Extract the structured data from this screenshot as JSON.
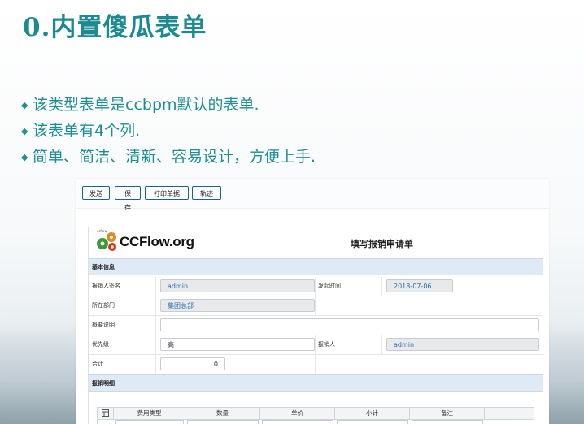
{
  "slide": {
    "title": "0.内置傻瓜表单",
    "bullets": [
      "该类型表单是ccbpm默认的表单.",
      "该表单有4个列.",
      "简单、简洁、清新、容易设计，方便上手."
    ],
    "accent_color": "#1c8a91"
  },
  "toolbar": {
    "send": "发送",
    "save": "保存",
    "print": "打印单据",
    "track": "轨迹"
  },
  "form": {
    "logo_text": "CCFlow.org",
    "logo_small": "ccflow",
    "title": "填写报销申请单",
    "section_basic": "基本信息",
    "section_detail": "报销明细",
    "fields": {
      "signer_label": "报销人签名",
      "signer_value": "admin",
      "time_label": "发起时间",
      "time_value": "2018-07-06",
      "dept_label": "所在部门",
      "dept_value": "集团总部",
      "summary_label": "概要说明",
      "summary_value": "",
      "priority_label": "优先级",
      "priority_value": "高",
      "reimburser_label": "报销人",
      "reimburser_value": "admin",
      "total_label": "合计",
      "total_value": "0"
    },
    "grid": {
      "columns": [
        "费用类型",
        "数量",
        "单价",
        "小计",
        "备注"
      ]
    }
  }
}
